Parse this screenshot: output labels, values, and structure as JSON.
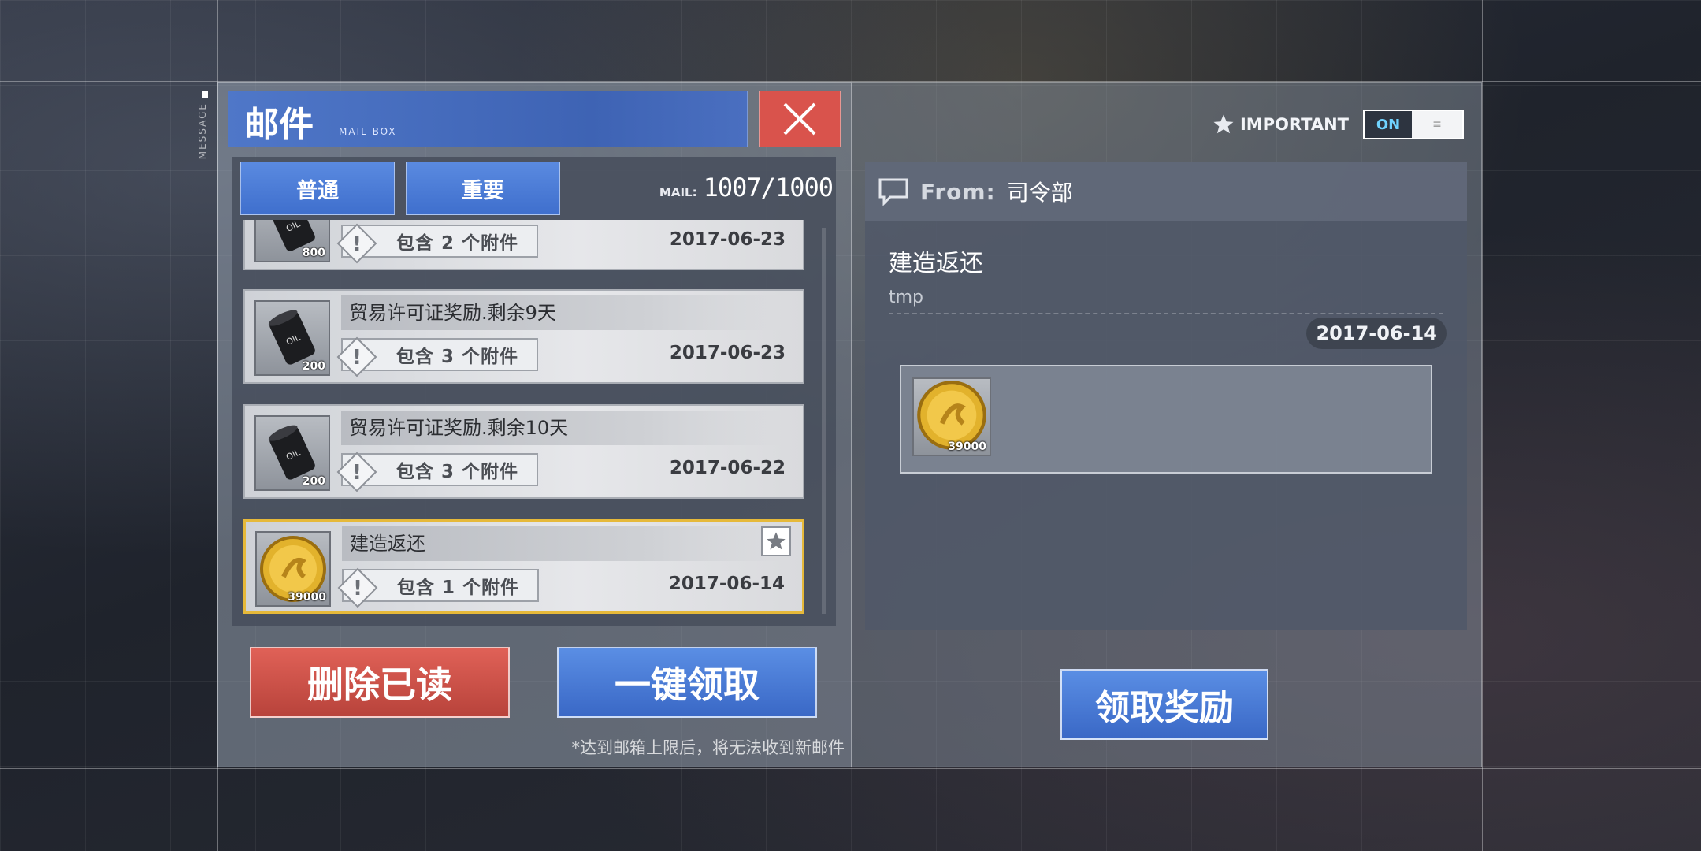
{
  "header": {
    "title_cn": "邮件",
    "title_en": "MAIL BOX",
    "side_tag": "MESSAGE"
  },
  "tabs": [
    {
      "label": "普通"
    },
    {
      "label": "重要"
    }
  ],
  "mail_count": {
    "label": "MAIL:",
    "value": "1007/1000"
  },
  "mails": [
    {
      "subject": "",
      "attach_text": "包含 2 个附件",
      "date": "2017-06-23",
      "item_icon": "oil-barrel-icon",
      "qty": "800"
    },
    {
      "subject": "贸易许可证奖励.剩余9天",
      "attach_text": "包含 3 个附件",
      "date": "2017-06-23",
      "item_icon": "oil-barrel-icon",
      "qty": "200"
    },
    {
      "subject": "贸易许可证奖励.剩余10天",
      "attach_text": "包含 3 个附件",
      "date": "2017-06-22",
      "item_icon": "oil-barrel-icon",
      "qty": "200"
    },
    {
      "subject": "建造返还",
      "attach_text": "包含 1 个附件",
      "date": "2017-06-14",
      "item_icon": "gold-coin-icon",
      "qty": "39000",
      "selected": true,
      "starred": true
    }
  ],
  "actions": {
    "delete_read": "删除已读",
    "claim_all": "一键领取",
    "limit_note": "*达到邮箱上限后，将无法收到新邮件"
  },
  "detail": {
    "important_label": "IMPORTANT",
    "toggle_state": "ON",
    "from_label": "From:",
    "from_value": "司令部",
    "title": "建造返还",
    "body": "tmp",
    "date": "2017-06-14",
    "reward_qty": "39000",
    "reward_icon": "gold-coin-icon",
    "claim_button": "领取奖励"
  },
  "colors": {
    "accent_blue": "#4a7bd6",
    "danger_red": "#d9534c",
    "selected_gold": "#e6b93a",
    "toggle_on": "#6fd2ff"
  }
}
